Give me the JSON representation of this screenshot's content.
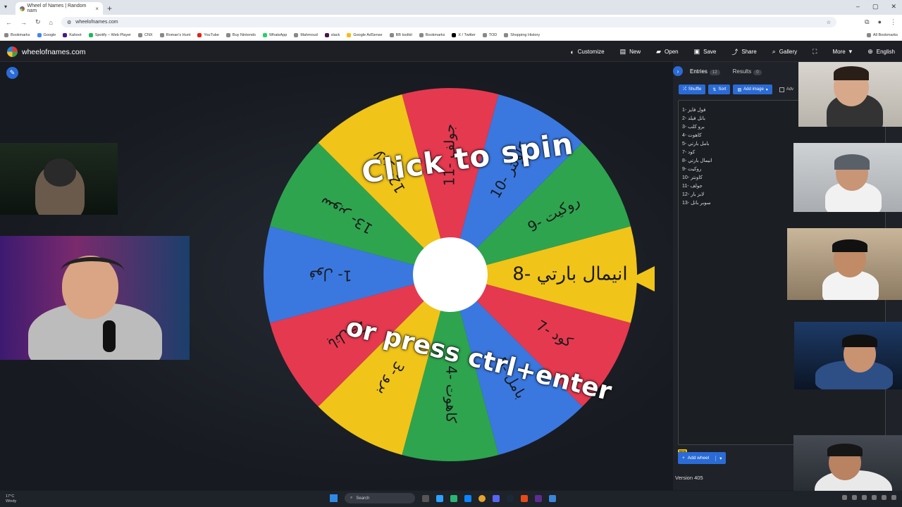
{
  "browser": {
    "tab_title": "Wheel of Names | Random nam",
    "address": "wheelofnames.com",
    "bookmarks": [
      "Bookmarks",
      "Google",
      "Kahoot",
      "Spotify – Web Player",
      "CNX",
      "Roman's Hunt",
      "YouTube",
      "Buy Nintendo",
      "WhatsApp",
      "Mahmoud",
      "slack",
      "Google AdSense",
      "BB toolkit",
      "Bookmarks",
      "X / Twitter",
      "TOD",
      "Shopping History",
      "All Bookmarks"
    ]
  },
  "site": {
    "name": "wheelofnames.com",
    "menu": {
      "customize": "Customize",
      "new": "New",
      "open": "Open",
      "save": "Save",
      "share": "Share",
      "gallery": "Gallery",
      "more": "More",
      "language": "English"
    }
  },
  "wheel": {
    "overlay_top": "Click to spin",
    "overlay_bottom": "or press ctrl+enter",
    "segments": [
      {
        "label": "8- انيمال بارتي",
        "color": "#f0c419"
      },
      {
        "label": "7- كود",
        "color": "#e53950"
      },
      {
        "label": "5- بامل",
        "color": "#3a78e0"
      },
      {
        "label": "4- كاهوت",
        "color": "#2ea44f"
      },
      {
        "label": "3- برو",
        "color": "#f0c419"
      },
      {
        "label": "2- باتل",
        "color": "#e53950"
      },
      {
        "label": "1- فول",
        "color": "#3a78e0"
      },
      {
        "label": "13- سوبر",
        "color": "#2ea44f"
      },
      {
        "label": "12- لابز",
        "color": "#f0c419"
      },
      {
        "label": "11- جولف",
        "color": "#e53950"
      },
      {
        "label": "10- كاونتر",
        "color": "#3a78e0"
      },
      {
        "label": "9- روكيت",
        "color": "#2ea44f"
      }
    ]
  },
  "panel": {
    "tab_entries": "Entries",
    "entries_count": "12",
    "tab_results": "Results",
    "results_count": "0",
    "shuffle": "Shuffle",
    "sort": "Sort",
    "add_image": "Add image",
    "advanced": "Adv",
    "entries": [
      "1- فول فايز",
      "2- باتل فيلد",
      "3- برو كلب",
      "4- كاهوت",
      "5- بامل بارتي",
      "7- كود",
      "8- انيمال بارتي",
      "9- روكيت",
      "10- كاونتر",
      "11- جولف",
      "12- لابز بار",
      "13- سوبر باتل"
    ],
    "beta": "Beta",
    "add_wheel": "Add wheel",
    "version": "Version 405"
  },
  "taskbar": {
    "temp": "17°C",
    "weather": "Windy",
    "search": "Search"
  }
}
